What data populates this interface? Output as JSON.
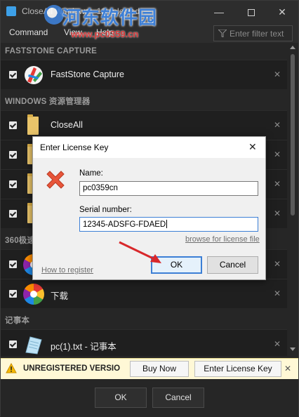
{
  "window": {
    "title": "CloseAll Windows - 12 selected",
    "controls": {
      "minimize": "—",
      "close": "✕"
    }
  },
  "watermark": {
    "text": "河东软件园",
    "url": "www.pc0359.cn"
  },
  "menu": {
    "items": [
      "Command",
      "View",
      "Help"
    ],
    "filter_placeholder": "Enter filter text"
  },
  "list": {
    "groups": [
      {
        "header": "FASTSTONE CAPTURE",
        "rows": [
          {
            "label": "FastStone Capture",
            "icon": "faststone-icon"
          }
        ]
      },
      {
        "header": "WINDOWS 资源管理器",
        "rows": [
          {
            "label": "CloseAll",
            "icon": "folder-icon"
          },
          {
            "label": "",
            "icon": "folder-icon"
          },
          {
            "label": "",
            "icon": "folder-icon"
          },
          {
            "label": "",
            "icon": "folder-icon"
          }
        ]
      },
      {
        "header": "360极速",
        "rows": [
          {
            "label": "",
            "icon": "pinwheel-icon"
          },
          {
            "label": "下载",
            "icon": "pinwheel-icon"
          }
        ]
      },
      {
        "header": "记事本",
        "rows": [
          {
            "label": "pc(1).txt - 记事本",
            "icon": "notepad-icon"
          }
        ]
      }
    ],
    "remove_glyph": "✕"
  },
  "registration_bar": {
    "text": "UNREGISTERED VERSIO",
    "buy_now": "Buy Now",
    "enter_license": "Enter License Key",
    "close": "✕"
  },
  "bottom": {
    "ok": "OK",
    "cancel": "Cancel"
  },
  "dialog": {
    "title": "Enter License Key",
    "close": "✕",
    "name_label": "Name:",
    "name_value": "pc0359cn",
    "serial_label": "Serial number:",
    "serial_value": "12345-ADSFG-FDAED",
    "browse_link": "browse for license file",
    "register_link": "How to register",
    "ok": "OK",
    "cancel": "Cancel"
  },
  "colors": {
    "accent": "#3c7fd5",
    "warning_bg": "#fff8d6",
    "annotation_arrow": "#d8282b"
  }
}
